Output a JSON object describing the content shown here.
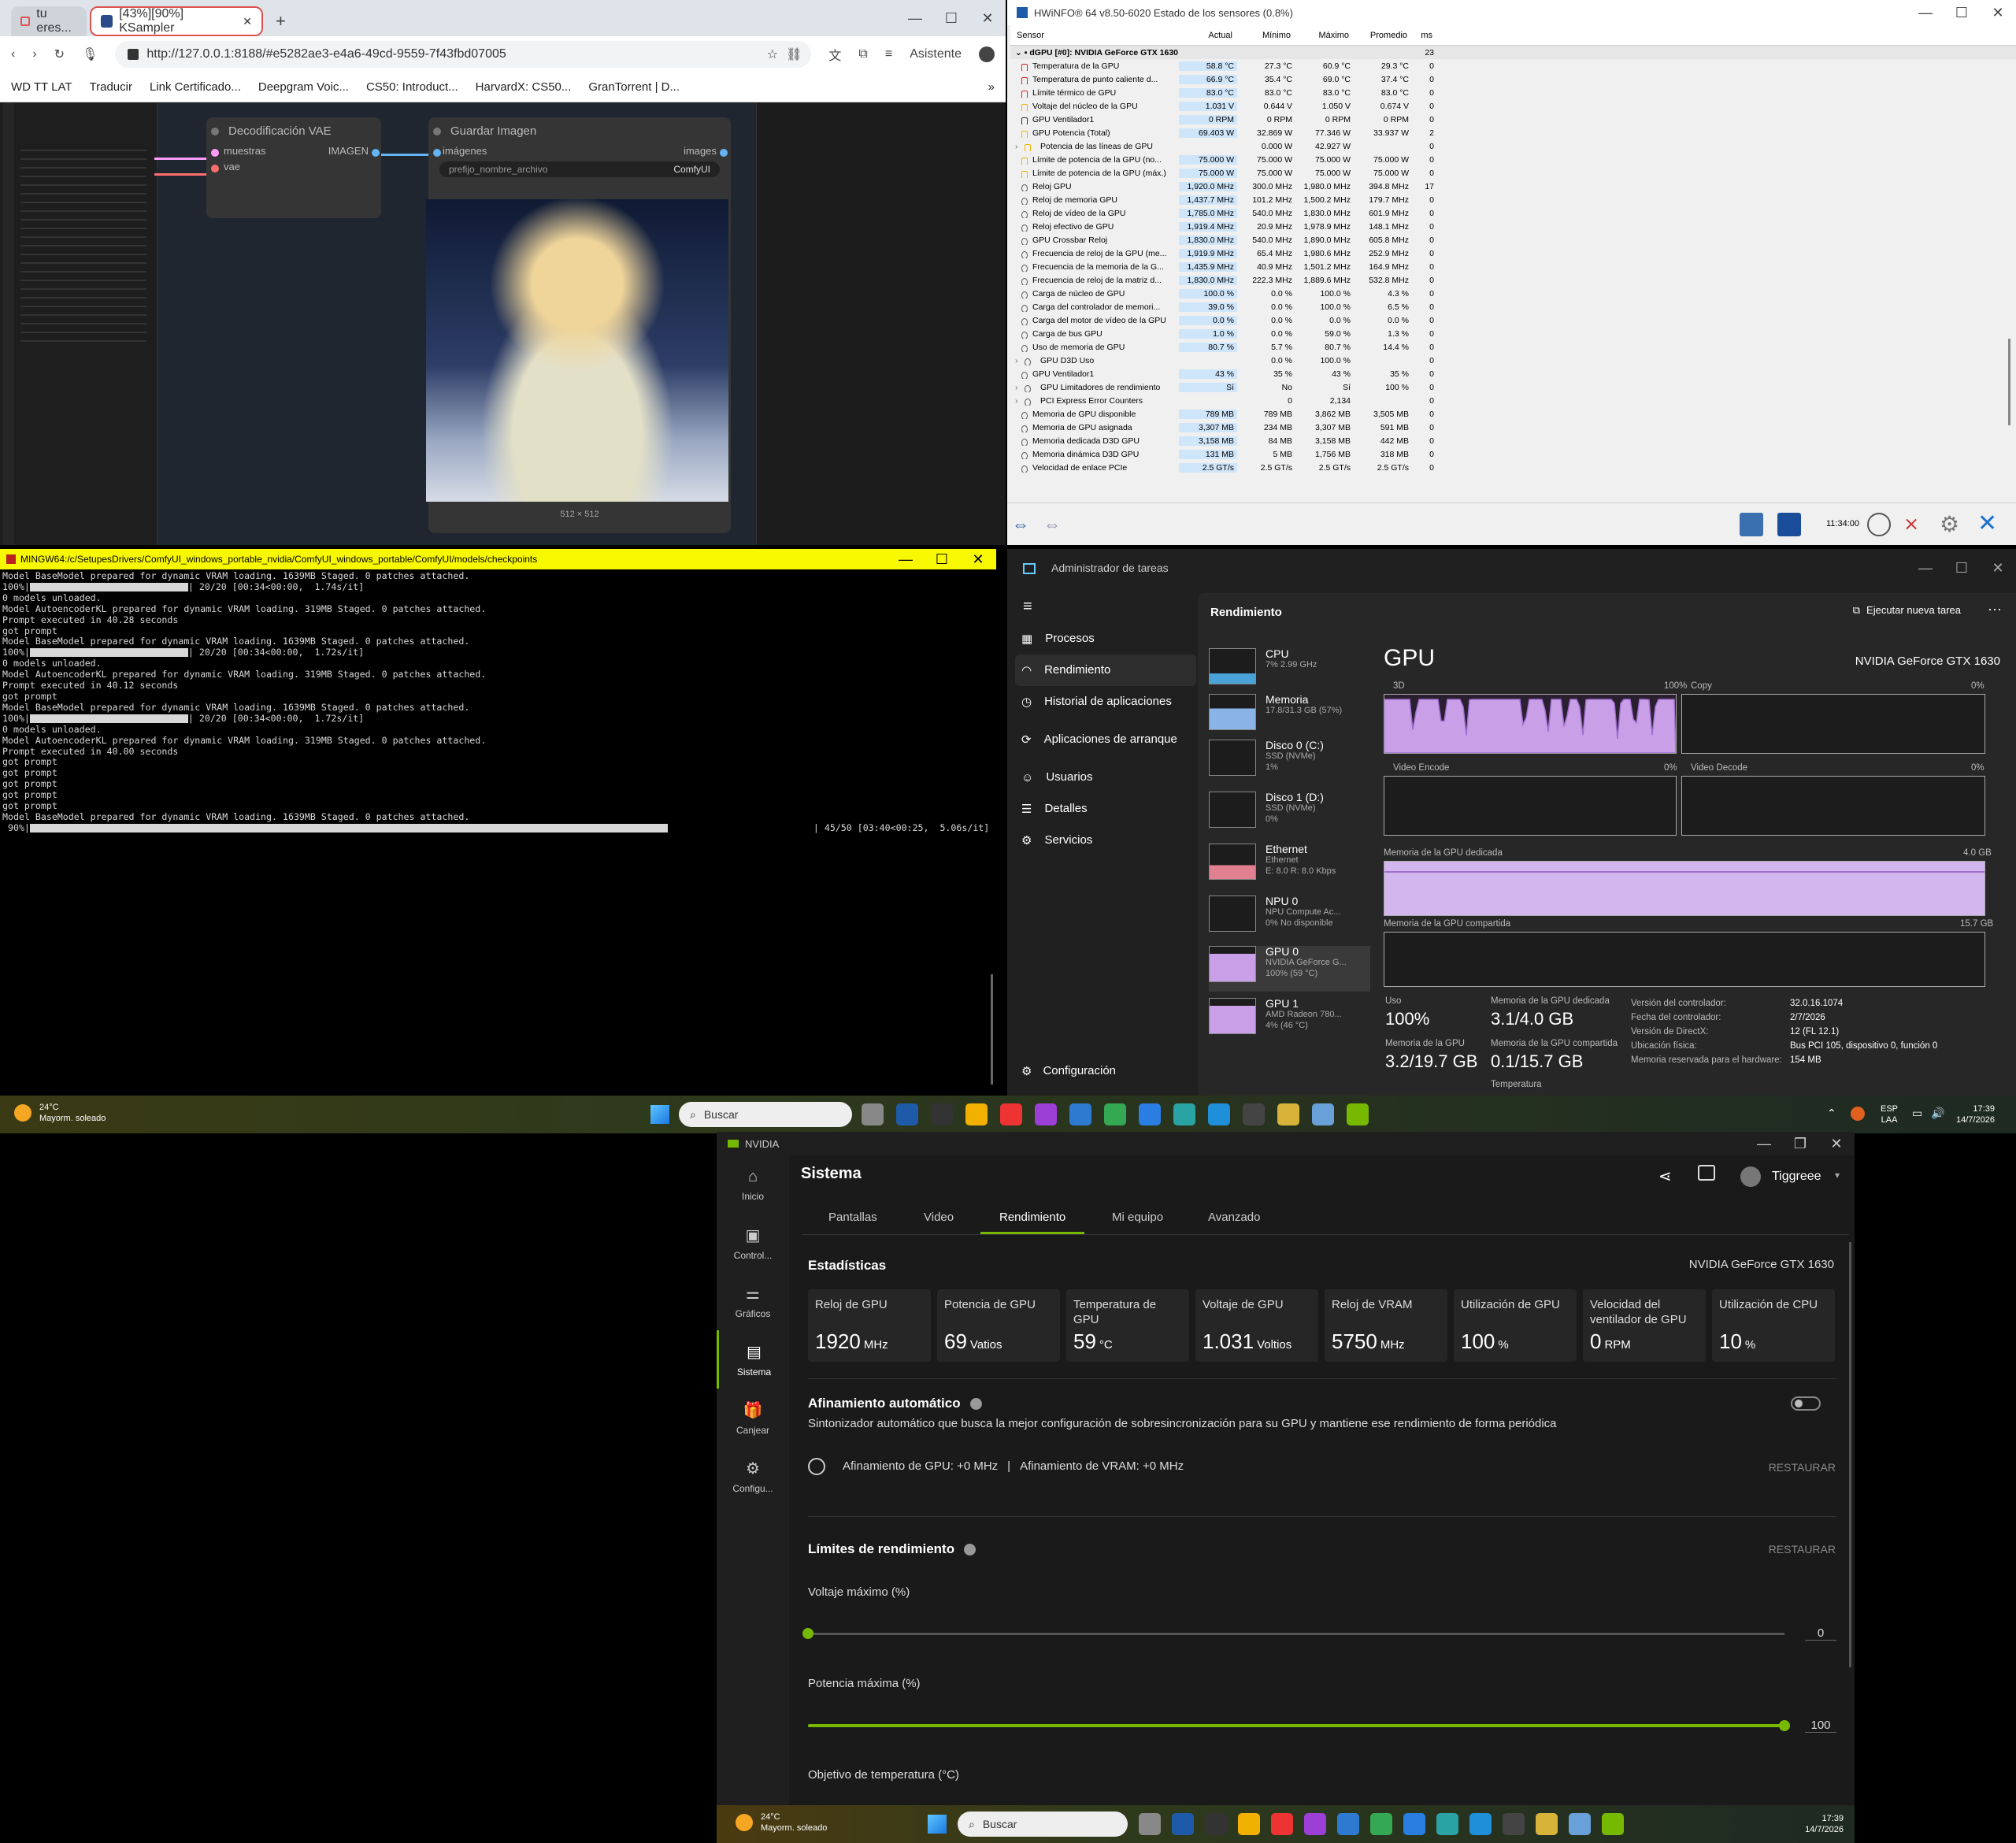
{
  "browser": {
    "tabs": [
      {
        "label": "tu eres..."
      },
      {
        "label": "[43%][90%] KSampler"
      }
    ],
    "new_tab": "+",
    "url": "http://127.0.0.1:8188/#e5282ae3-e4a6-49cd-9559-7f43fbd07005",
    "assistant": "Asistente",
    "bookmarks": [
      "WD TT LAT",
      "Traducir",
      "Link Certificado...",
      "Deepgram Voic...",
      "CS50: Introduct...",
      "HarvardX: CS50...",
      "GranTorrent | D..."
    ],
    "bookmarks_more": "»"
  },
  "comfy": {
    "vae_node": {
      "title": "Decodificación VAE",
      "in1": "muestras",
      "in2": "vae",
      "out": "IMAGEN"
    },
    "save_node": {
      "title": "Guardar Imagen",
      "in": "imágenes",
      "out": "images",
      "prefix_label": "prefijo_nombre_archivo",
      "prefix_value": "ComfyUI",
      "size": "512 × 512"
    }
  },
  "hwinfo": {
    "title": "HWiNFO® 64 v8.50-6020 Estado de los sensores (0.8%)",
    "headers": [
      "Sensor",
      "Actual",
      "Mínimo",
      "Máximo",
      "Promedio",
      "ms"
    ],
    "group": "dGPU [#0]: NVIDIA GeForce GTX 1630",
    "group_ms": "23",
    "rows": [
      {
        "n": "Temperatura de la GPU",
        "a": "58.8 °C",
        "mi": "27.3 °C",
        "ma": "60.9 °C",
        "p": "29.3 °C",
        "ms": "0",
        "ic": "therm"
      },
      {
        "n": "Temperatura de punto caliente d...",
        "a": "66.9 °C",
        "mi": "35.4 °C",
        "ma": "69.0 °C",
        "p": "37.4 °C",
        "ms": "0",
        "ic": "therm"
      },
      {
        "n": "Límite térmico de GPU",
        "a": "83.0 °C",
        "mi": "83.0 °C",
        "ma": "83.0 °C",
        "p": "83.0 °C",
        "ms": "0",
        "ic": "therm"
      },
      {
        "n": "Voltaje del núcleo de la GPU",
        "a": "1.031 V",
        "mi": "0.644 V",
        "ma": "1.050 V",
        "p": "0.674 V",
        "ms": "0",
        "ic": "bolt"
      },
      {
        "n": "GPU Ventilador1",
        "a": "0 RPM",
        "mi": "0 RPM",
        "ma": "0 RPM",
        "p": "0 RPM",
        "ms": "0",
        "ic": "fan"
      },
      {
        "n": "GPU Potencia (Total)",
        "a": "69.403 W",
        "mi": "32.869 W",
        "ma": "77.346 W",
        "p": "33.937 W",
        "ms": "2",
        "ic": "bolt"
      },
      {
        "n": "Potencia de las líneas de GPU",
        "a": "",
        "mi": "0.000 W",
        "ma": "42.927 W",
        "p": "",
        "ms": "0",
        "ic": "bolt",
        "sub": true
      },
      {
        "n": "Límite de potencia de la GPU (no...",
        "a": "75.000 W",
        "mi": "75.000 W",
        "ma": "75.000 W",
        "p": "75.000 W",
        "ms": "0",
        "ic": "bolt"
      },
      {
        "n": "Límite de potencia de la GPU (máx.)",
        "a": "75.000 W",
        "mi": "75.000 W",
        "ma": "75.000 W",
        "p": "75.000 W",
        "ms": "0",
        "ic": "bolt"
      },
      {
        "n": "Reloj GPU",
        "a": "1,920.0 MHz",
        "mi": "300.0 MHz",
        "ma": "1,980.0 MHz",
        "p": "394.8 MHz",
        "ms": "17",
        "ic": "clock"
      },
      {
        "n": "Reloj de memoria GPU",
        "a": "1,437.7 MHz",
        "mi": "101.2 MHz",
        "ma": "1,500.2 MHz",
        "p": "179.7 MHz",
        "ms": "0",
        "ic": "clock"
      },
      {
        "n": "Reloj de vídeo de la GPU",
        "a": "1,785.0 MHz",
        "mi": "540.0 MHz",
        "ma": "1,830.0 MHz",
        "p": "601.9 MHz",
        "ms": "0",
        "ic": "clock"
      },
      {
        "n": "Reloj efectivo de GPU",
        "a": "1,919.4 MHz",
        "mi": "20.9 MHz",
        "ma": "1,978.9 MHz",
        "p": "148.1 MHz",
        "ms": "0",
        "ic": "clock"
      },
      {
        "n": "GPU Crossbar Reloj",
        "a": "1,830.0 MHz",
        "mi": "540.0 MHz",
        "ma": "1,890.0 MHz",
        "p": "605.8 MHz",
        "ms": "0",
        "ic": "clock"
      },
      {
        "n": "Frecuencia de reloj de la GPU (me...",
        "a": "1,919.9 MHz",
        "mi": "65.4 MHz",
        "ma": "1,980.6 MHz",
        "p": "252.9 MHz",
        "ms": "0",
        "ic": "clock"
      },
      {
        "n": "Frecuencia de la memoria de la G...",
        "a": "1,435.9 MHz",
        "mi": "40.9 MHz",
        "ma": "1,501.2 MHz",
        "p": "164.9 MHz",
        "ms": "0",
        "ic": "clock"
      },
      {
        "n": "Frecuencia de reloj de la matriz d...",
        "a": "1,830.0 MHz",
        "mi": "222.3 MHz",
        "ma": "1,889.6 MHz",
        "p": "532.8 MHz",
        "ms": "0",
        "ic": "clock"
      },
      {
        "n": "Carga de núcleo de GPU",
        "a": "100.0 %",
        "mi": "0.0 %",
        "ma": "100.0 %",
        "p": "4.3 %",
        "ms": "0",
        "ic": "clock"
      },
      {
        "n": "Carga del controlador de memori...",
        "a": "39.0 %",
        "mi": "0.0 %",
        "ma": "100.0 %",
        "p": "6.5 %",
        "ms": "0",
        "ic": "clock"
      },
      {
        "n": "Carga del motor de vídeo de la GPU",
        "a": "0.0 %",
        "mi": "0.0 %",
        "ma": "0.0 %",
        "p": "0.0 %",
        "ms": "0",
        "ic": "clock"
      },
      {
        "n": "Carga de bus GPU",
        "a": "1.0 %",
        "mi": "0.0 %",
        "ma": "59.0 %",
        "p": "1.3 %",
        "ms": "0",
        "ic": "clock"
      },
      {
        "n": "Uso de memoria de GPU",
        "a": "80.7 %",
        "mi": "5.7 %",
        "ma": "80.7 %",
        "p": "14.4 %",
        "ms": "0",
        "ic": "clock"
      },
      {
        "n": "GPU D3D Uso",
        "a": "",
        "mi": "0.0 %",
        "ma": "100.0 %",
        "p": "",
        "ms": "0",
        "ic": "clock",
        "sub": true
      },
      {
        "n": "GPU Ventilador1",
        "a": "43 %",
        "mi": "35 %",
        "ma": "43 %",
        "p": "35 %",
        "ms": "0",
        "ic": "clock"
      },
      {
        "n": "GPU Limitadores de rendimiento",
        "a": "Sí",
        "mi": "No",
        "ma": "Sí",
        "p": "100 %",
        "ms": "0",
        "ic": "clock",
        "sub": true
      },
      {
        "n": "PCI Express Error Counters",
        "a": "",
        "mi": "0",
        "ma": "2,134",
        "p": "",
        "ms": "0",
        "ic": "clock",
        "sub": true
      },
      {
        "n": "Memoria de GPU disponible",
        "a": "789 MB",
        "mi": "789 MB",
        "ma": "3,862 MB",
        "p": "3,505 MB",
        "ms": "0",
        "ic": "clock"
      },
      {
        "n": "Memoria de GPU asignada",
        "a": "3,307 MB",
        "mi": "234 MB",
        "ma": "3,307 MB",
        "p": "591 MB",
        "ms": "0",
        "ic": "clock"
      },
      {
        "n": "Memoria dedicada D3D GPU",
        "a": "3,158 MB",
        "mi": "84 MB",
        "ma": "3,158 MB",
        "p": "442 MB",
        "ms": "0",
        "ic": "clock"
      },
      {
        "n": "Memoria dinámica D3D GPU",
        "a": "131 MB",
        "mi": "5 MB",
        "ma": "1,756 MB",
        "p": "318 MB",
        "ms": "0",
        "ic": "clock"
      },
      {
        "n": "Velocidad de enlace PCIe",
        "a": "2.5 GT/s",
        "mi": "2.5 GT/s",
        "ma": "2.5 GT/s",
        "p": "2.5 GT/s",
        "ms": "0",
        "ic": "clock"
      }
    ],
    "time": "11:34:00"
  },
  "terminal": {
    "title": "MINGW64:/c/SetupesDrivers/ComfyUI_windows_portable_nvidia/ComfyUI_windows_portable/ComfyUI/models/checkpoints",
    "lines": [
      "Model BaseModel prepared for dynamic VRAM loading. 1639MB Staged. 0 patches attached.",
      "@@BAR1",
      "0 models unloaded.",
      "Model AutoencoderKL prepared for dynamic VRAM loading. 319MB Staged. 0 patches attached.",
      "Prompt executed in 40.28 seconds",
      "got prompt",
      "Model BaseModel prepared for dynamic VRAM loading. 1639MB Staged. 0 patches attached.",
      "@@BAR2",
      "0 models unloaded.",
      "Model AutoencoderKL prepared for dynamic VRAM loading. 319MB Staged. 0 patches attached.",
      "Prompt executed in 40.12 seconds",
      "got prompt",
      "Model BaseModel prepared for dynamic VRAM loading. 1639MB Staged. 0 patches attached.",
      "@@BAR3",
      "0 models unloaded.",
      "Model AutoencoderKL prepared for dynamic VRAM loading. 319MB Staged. 0 patches attached.",
      "Prompt executed in 40.00 seconds",
      "got prompt",
      "got prompt",
      "got prompt",
      "got prompt",
      "got prompt",
      "Model BaseModel prepared for dynamic VRAM loading. 1639MB Staged. 0 patches attached.",
      "@@BAR4"
    ],
    "bars": [
      {
        "pct": "100%",
        "frac": 1.0,
        "tail": "| 20/20 [00:34<00:00,  1.74s/it]"
      },
      {
        "pct": "100%",
        "frac": 1.0,
        "tail": "| 20/20 [00:34<00:00,  1.72s/it]"
      },
      {
        "pct": "100%",
        "frac": 1.0,
        "tail": "| 20/20 [00:34<00:00,  1.72s/it]"
      },
      {
        "pct": " 90%",
        "frac": 0.9,
        "tail": "| 45/50 [03:40<00:25,  5.06s/it]"
      }
    ]
  },
  "taskmgr": {
    "title": "Administrador de tareas",
    "section": "Rendimiento",
    "run_task": "Ejecutar nueva tarea",
    "nav": [
      "Procesos",
      "Rendimiento",
      "Historial de aplicaciones",
      "Aplicaciones de arranque",
      "Usuarios",
      "Detalles",
      "Servicios"
    ],
    "settings": "Configuración",
    "items": [
      {
        "name": "CPU",
        "sub1": "7% 2.99 GHz",
        "sub2": ""
      },
      {
        "name": "Memoria",
        "sub1": "17.8/31.3 GB (57%)",
        "sub2": ""
      },
      {
        "name": "Disco 0 (C:)",
        "sub1": "SSD (NVMe)",
        "sub2": "1%"
      },
      {
        "name": "Disco 1 (D:)",
        "sub1": "SSD (NVMe)",
        "sub2": "0%"
      },
      {
        "name": "Ethernet",
        "sub1": "Ethernet",
        "sub2": "E: 8.0 R: 8.0 Kbps"
      },
      {
        "name": "NPU 0",
        "sub1": "NPU Compute Ac...",
        "sub2": "0% No disponible"
      },
      {
        "name": "GPU 0",
        "sub1": "NVIDIA GeForce G...",
        "sub2": "100% (59 °C)"
      },
      {
        "name": "GPU 1",
        "sub1": "AMD Radeon 780...",
        "sub2": "4% (46 °C)"
      }
    ],
    "gpu_title": "GPU",
    "gpu_name": "NVIDIA GeForce GTX 1630",
    "g3d": "3D",
    "g3d_max": "100%",
    "gcopy": "Copy",
    "gcopy_max": "0%",
    "genc": "Video Encode",
    "genc_max": "0%",
    "gdec": "Video Decode",
    "gdec_max": "0%",
    "mem_ded_label": "Memoria de la GPU dedicada",
    "mem_ded_max": "4.0 GB",
    "mem_sh_label": "Memoria de la GPU compartida",
    "mem_sh_max": "15.7 GB",
    "uso_label": "Uso",
    "uso_value": "100%",
    "ded_label": "Memoria de la GPU dedicada",
    "ded_value": "3.1/4.0 GB",
    "gpumem_label": "Memoria de la GPU",
    "gpumem_value": "3.2/19.7 GB",
    "shared_label": "Memoria de la GPU compartida",
    "shared_value": "0.1/15.7 GB",
    "temp_label": "Temperatura",
    "details": [
      {
        "k": "Versión del controlador:",
        "v": "32.0.16.1074"
      },
      {
        "k": "Fecha del controlador:",
        "v": "2/7/2026"
      },
      {
        "k": "Versión de DirectX:",
        "v": "12 (FL 12.1)"
      },
      {
        "k": "Ubicación física:",
        "v": "Bus PCI 105, dispositivo 0, función 0"
      },
      {
        "k": "Memoria reservada para el hardware:",
        "v": "154 MB"
      }
    ]
  },
  "taskbar": {
    "weather_temp": "24°C",
    "weather_desc": "Mayorm. soleado",
    "search": "Buscar",
    "lang1": "ESP",
    "lang2": "LAA",
    "time": "17:39",
    "date": "14/7/2026"
  },
  "nvidia": {
    "app_title": "NVIDIA",
    "nav": [
      "Inicio",
      "Control...",
      "Gráficos",
      "Sistema",
      "Canjear",
      "Configu..."
    ],
    "page_title": "Sistema",
    "user": "Tiggreee",
    "tabs": [
      "Pantallas",
      "Video",
      "Rendimiento",
      "Mi equipo",
      "Avanzado"
    ],
    "stats_title": "Estadísticas",
    "gpu_name": "NVIDIA GeForce GTX 1630",
    "stats": [
      {
        "label": "Reloj de GPU",
        "value": "1920",
        "unit": "MHz"
      },
      {
        "label": "Potencia de GPU",
        "value": "69",
        "unit": "Vatios"
      },
      {
        "label": "Temperatura de GPU",
        "value": "59",
        "unit": "°C"
      },
      {
        "label": "Voltaje de GPU",
        "value": "1.031",
        "unit": "Voltios"
      },
      {
        "label": "Reloj de VRAM",
        "value": "5750",
        "unit": "MHz"
      },
      {
        "label": "Utilización de GPU",
        "value": "100",
        "unit": "%"
      },
      {
        "label": "Velocidad del ventilador de GPU",
        "value": "0",
        "unit": "RPM"
      },
      {
        "label": "Utilización de CPU",
        "value": "10",
        "unit": "%"
      }
    ],
    "autotune_title": "Afinamiento automático",
    "autotune_desc": "Sintonizador automático que busca la mejor configuración de sobresincronización para su GPU y mantiene ese rendimiento de forma periódica",
    "autotune_gpu": "Afinamiento de GPU: +0 MHz",
    "autotune_vram": "Afinamiento de VRAM: +0 MHz",
    "restore": "RESTAURAR",
    "limits_title": "Límites de rendimiento",
    "volt_label": "Voltaje máximo (%)",
    "volt_value": "0",
    "volt_frac": 0,
    "power_label": "Potencia máxima (%)",
    "power_value": "100",
    "power_frac": 1,
    "temp_target": "Objetivo de temperatura (°C)"
  }
}
